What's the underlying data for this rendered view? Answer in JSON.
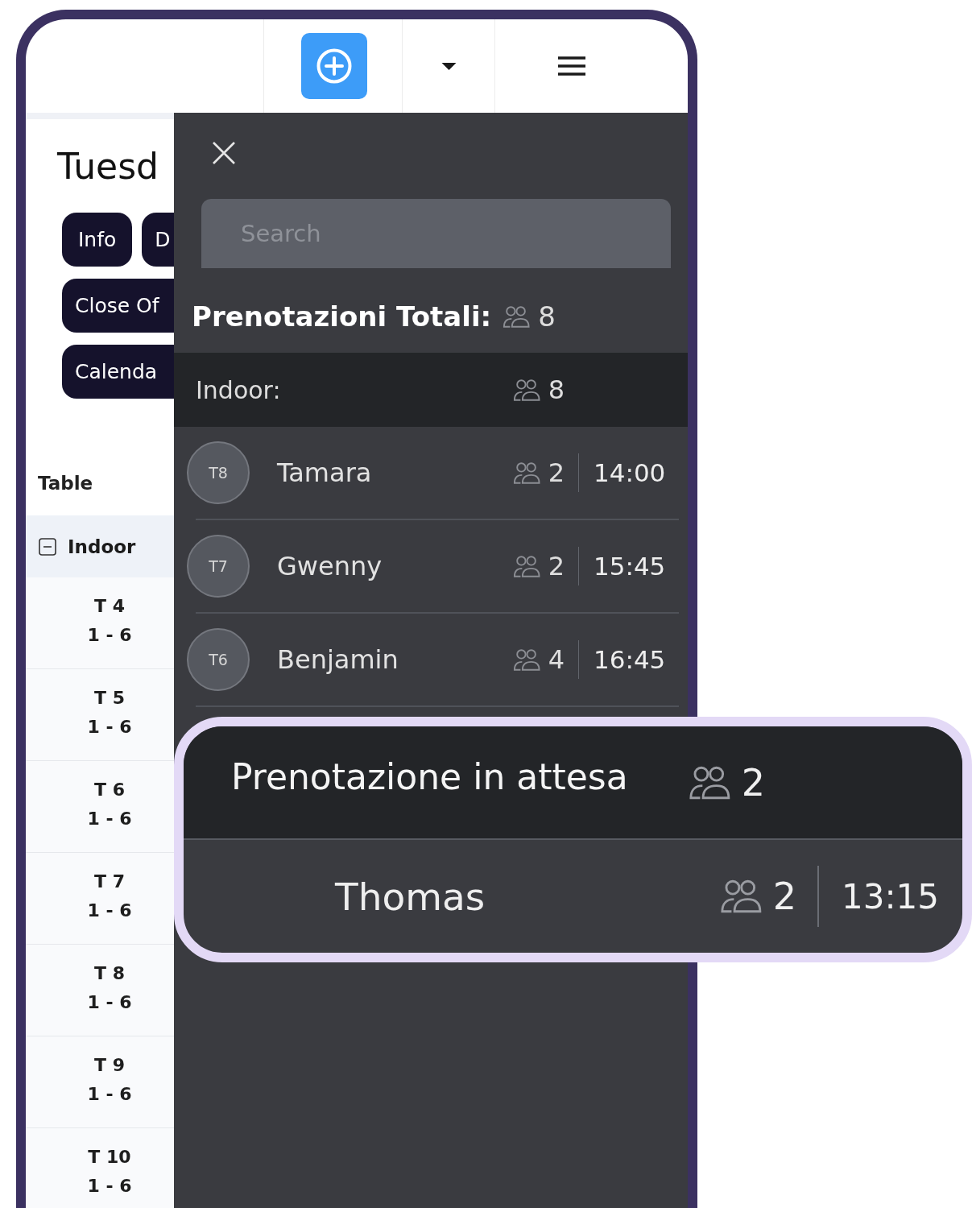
{
  "day_panel": {
    "title": "Tuesd",
    "buttons": [
      "Info",
      "D",
      "Close Of",
      "Calenda"
    ]
  },
  "table": {
    "header": "Table",
    "groups": [
      {
        "name": "Indoor",
        "expanded": true,
        "children": [
          {
            "name": "T 4",
            "capacity": "1 - 6"
          },
          {
            "name": "T 5",
            "capacity": "1 - 6"
          },
          {
            "name": "T 6",
            "capacity": "1 - 6"
          },
          {
            "name": "T 7",
            "capacity": "1 - 6"
          },
          {
            "name": "T 8",
            "capacity": "1 - 6"
          },
          {
            "name": "T 9",
            "capacity": "1 - 6"
          },
          {
            "name": "T 10",
            "capacity": "1 - 6"
          }
        ]
      }
    ]
  },
  "drawer": {
    "search": {
      "placeholder": "Search"
    },
    "total": {
      "label": "Prenotazioni Totali:",
      "guests": "8"
    },
    "sections": [
      {
        "name": "Indoor:",
        "guests": "8",
        "reservations": [
          {
            "table": "T8",
            "name": "Tamara",
            "guests": "2",
            "time": "14:00"
          },
          {
            "table": "T7",
            "name": "Gwenny",
            "guests": "2",
            "time": "15:45"
          },
          {
            "table": "T6",
            "name": "Benjamin",
            "guests": "4",
            "time": "16:45"
          }
        ]
      }
    ]
  },
  "waiting": {
    "title": "Prenotazione in attesa",
    "guests": "2",
    "reservations": [
      {
        "name": "Thomas",
        "guests": "2",
        "time": "13:15"
      }
    ]
  }
}
